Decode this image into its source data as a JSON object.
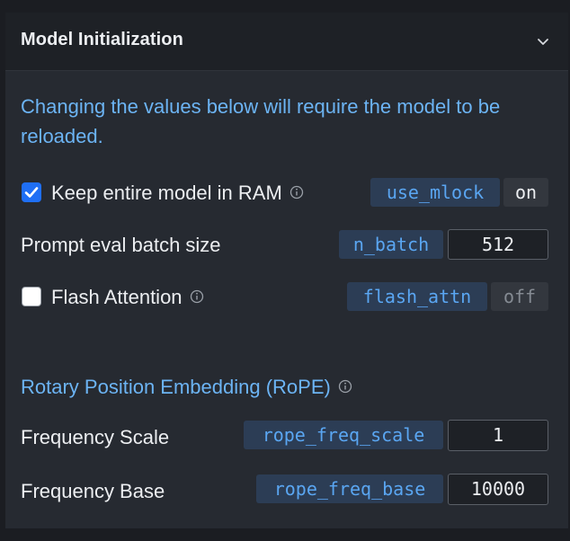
{
  "section": {
    "title": "Model Initialization",
    "notice": "Changing the values below will require the model to be reloaded."
  },
  "settings": [
    {
      "label": "Keep entire model in RAM",
      "param": "use_mlock",
      "value": "on",
      "checked": true
    },
    {
      "label": "Prompt eval batch size",
      "param": "n_batch",
      "value": "512"
    },
    {
      "label": "Flash Attention",
      "param": "flash_attn",
      "value": "off",
      "checked": false
    }
  ],
  "rope": {
    "heading": "Rotary Position Embedding (RoPE)",
    "items": [
      {
        "label": "Frequency Scale",
        "param": "rope_freq_scale",
        "value": "1"
      },
      {
        "label": "Frequency Base",
        "param": "rope_freq_base",
        "value": "10000"
      }
    ]
  },
  "icons": {
    "collapse": "chevron-down-icon",
    "info": "info-icon",
    "check": "checkmark-icon"
  },
  "colors": {
    "accent_text": "#6cb4f4",
    "tag_bg": "#2c3d55",
    "checkbox_checked": "#1f6ff5"
  }
}
